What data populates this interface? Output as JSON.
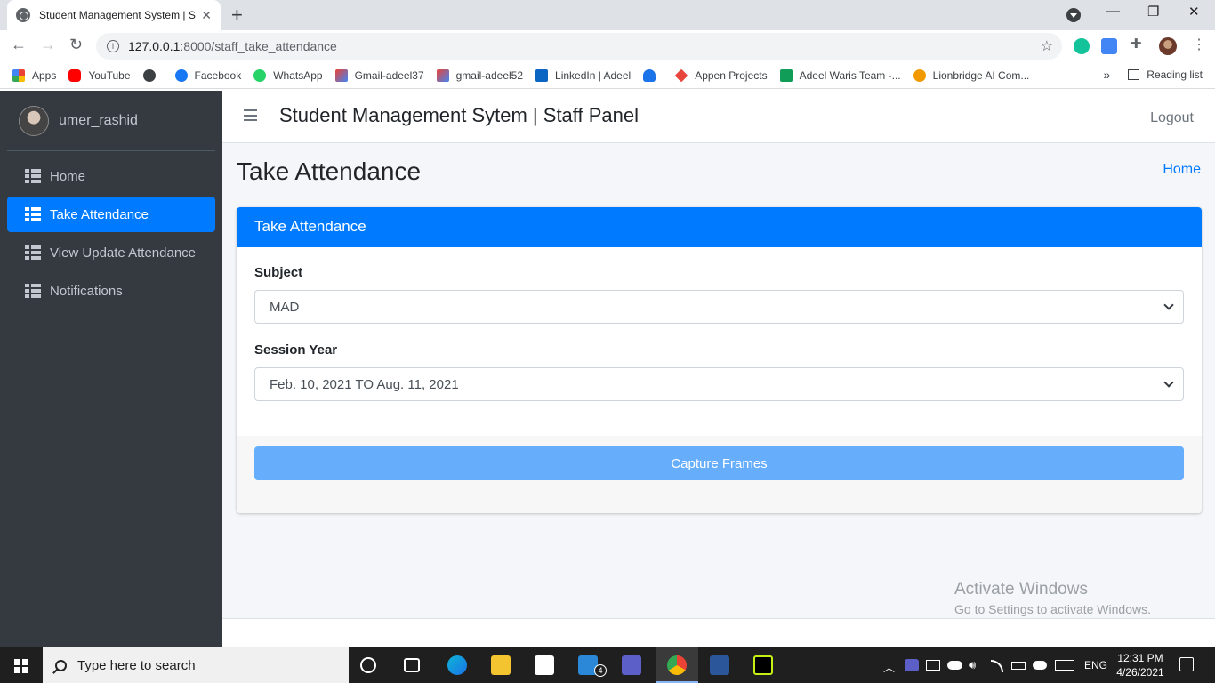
{
  "browser": {
    "tab_title": "Student Management System | St",
    "url_host": "127.0.0.1",
    "url_path": ":8000/staff_take_attendance",
    "bookmarks": [
      {
        "label": "Apps",
        "color": "#ea4335"
      },
      {
        "label": "YouTube",
        "color": "#ff0000"
      },
      {
        "label": "",
        "color": "#3c4043"
      },
      {
        "label": "Facebook",
        "color": "#1877f2"
      },
      {
        "label": "WhatsApp",
        "color": "#25d366"
      },
      {
        "label": "Gmail-adeel37",
        "color": "#d93025"
      },
      {
        "label": "gmail-adeel52",
        "color": "#d93025"
      },
      {
        "label": "LinkedIn | Adeel",
        "color": "#0a66c2"
      },
      {
        "label": "",
        "color": "#1a73e8"
      },
      {
        "label": "Appen Projects",
        "color": "#e8453c"
      },
      {
        "label": "Adeel Waris Team -...",
        "color": "#0f9d58"
      },
      {
        "label": "Lionbridge AI Com...",
        "color": "#f29900"
      }
    ],
    "bookmarks_overflow": "»",
    "reading_list": "Reading list"
  },
  "sidebar": {
    "username": "umer_rashid",
    "items": [
      {
        "label": "Home",
        "active": false
      },
      {
        "label": "Take Attendance",
        "active": true
      },
      {
        "label": "View Update Attendance",
        "active": false
      },
      {
        "label": "Notifications",
        "active": false
      }
    ]
  },
  "header": {
    "brand": "Student Management Sytem | Staff Panel",
    "logout": "Logout"
  },
  "page": {
    "title": "Take Attendance",
    "breadcrumb": "Home"
  },
  "card": {
    "title": "Take Attendance",
    "subject_label": "Subject",
    "subject_value": "MAD",
    "session_label": "Session Year",
    "session_value": "Feb. 10, 2021 TO Aug. 11, 2021",
    "button": "Capture Frames"
  },
  "watermark": {
    "line1": "Activate Windows",
    "line2": "Go to Settings to activate Windows."
  },
  "taskbar": {
    "search_placeholder": "Type here to search",
    "language": "ENG",
    "time": "12:31 PM",
    "date": "4/26/2021",
    "mail_badge": "4"
  },
  "colors": {
    "accent": "#007bff",
    "sidebar_bg": "#343a40",
    "button": "#66aefc"
  }
}
